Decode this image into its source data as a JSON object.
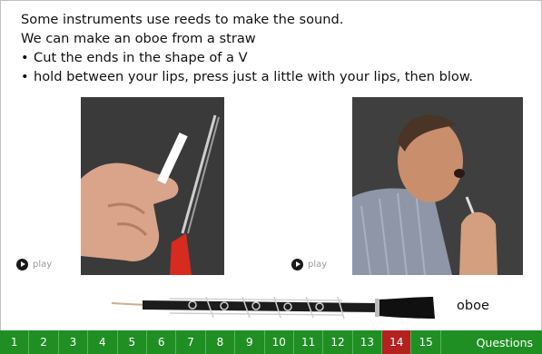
{
  "text": {
    "line1": "Some instruments use reeds to make the sound.",
    "line2": "We can make an oboe from a straw",
    "bullet_char": "•",
    "bullet1": "Cut the ends in the shape of a V",
    "bullet2": "hold between your lips, press just a little with your lips, then blow."
  },
  "play_label": "play",
  "instrument_label": "oboe",
  "nav": {
    "pages": [
      "1",
      "2",
      "3",
      "4",
      "5",
      "6",
      "7",
      "8",
      "9",
      "10",
      "11",
      "12",
      "13",
      "14",
      "15"
    ],
    "active_page": "14",
    "questions_label": "Questions"
  },
  "colors": {
    "nav_green": "#1f8f23",
    "active_red": "#b3221f"
  }
}
